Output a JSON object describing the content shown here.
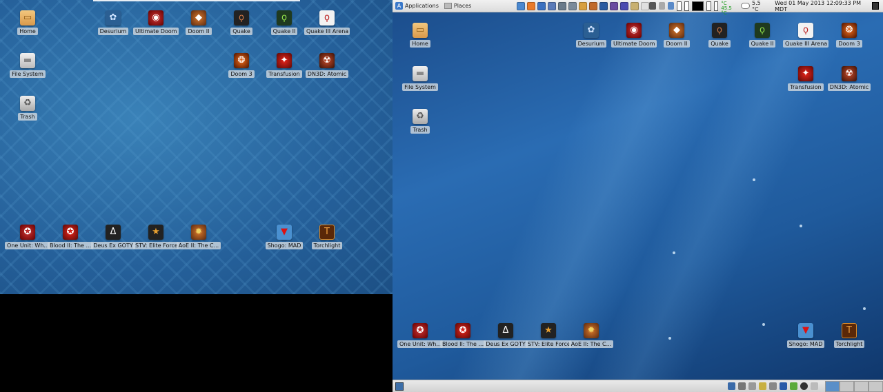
{
  "left_desktop": {
    "icons": [
      {
        "label": "Home",
        "icon": "folder-icon",
        "glyph": "▭"
      },
      {
        "label": "Desurium",
        "icon": "desura-icon",
        "glyph": "✿"
      },
      {
        "label": "Ultimate Doom",
        "icon": "doom-icon",
        "glyph": "◉"
      },
      {
        "label": "Doom II",
        "icon": "doom2-icon",
        "glyph": "◆"
      },
      {
        "label": "Quake",
        "icon": "quake-icon",
        "glyph": "ϙ"
      },
      {
        "label": "Quake II",
        "icon": "quake2-icon",
        "glyph": "ϙ"
      },
      {
        "label": "Quake III Arena",
        "icon": "quake3-icon",
        "glyph": "ϙ"
      },
      {
        "label": "File System",
        "icon": "drive-icon",
        "glyph": "▬"
      },
      {
        "label": "Doom 3",
        "icon": "doom3-icon",
        "glyph": "❂"
      },
      {
        "label": "Transfusion",
        "icon": "transfusion-icon",
        "glyph": "✦"
      },
      {
        "label": "DN3D: Atomic",
        "icon": "duke-icon",
        "glyph": "☢"
      },
      {
        "label": "Trash",
        "icon": "trash-icon",
        "glyph": "♻"
      },
      {
        "label": "One Unit: Wh...",
        "icon": "one-unit-icon",
        "glyph": "✪"
      },
      {
        "label": "Blood II: The ...",
        "icon": "blood2-icon",
        "glyph": "✪"
      },
      {
        "label": "Deus Ex GOTY",
        "icon": "deus-ex-icon",
        "glyph": "Δ"
      },
      {
        "label": "STV: Elite Force",
        "icon": "stv-icon",
        "glyph": "★"
      },
      {
        "label": "AoE II: The C...",
        "icon": "aoe2-icon",
        "glyph": "✹"
      },
      {
        "label": "Shogo: MAD",
        "icon": "shogo-icon",
        "glyph": "▼"
      },
      {
        "label": "Torchlight",
        "icon": "torchlight-icon",
        "glyph": "T"
      }
    ]
  },
  "right_desktop": {
    "top_panel": {
      "applications_label": "Applications",
      "places_label": "Places",
      "temp_cpu": "36.0 °C",
      "temp_gpu": "45.5 °C",
      "weather": "5.5 °C",
      "clock": "Wed 01 May 2013 12:09:33 PM MDT"
    },
    "icons": [
      {
        "label": "Home",
        "icon": "folder-icon",
        "glyph": "▭"
      },
      {
        "label": "Desurium",
        "icon": "desura-icon",
        "glyph": "✿"
      },
      {
        "label": "Ultimate Doom",
        "icon": "doom-icon",
        "glyph": "◉"
      },
      {
        "label": "Doom II",
        "icon": "doom2-icon",
        "glyph": "◆"
      },
      {
        "label": "Quake",
        "icon": "quake-icon",
        "glyph": "ϙ"
      },
      {
        "label": "Quake II",
        "icon": "quake2-icon",
        "glyph": "ϙ"
      },
      {
        "label": "Quake III Arena",
        "icon": "quake3-icon",
        "glyph": "ϙ"
      },
      {
        "label": "Doom 3",
        "icon": "doom3-icon",
        "glyph": "❂"
      },
      {
        "label": "File System",
        "icon": "drive-icon",
        "glyph": "▬"
      },
      {
        "label": "Transfusion",
        "icon": "transfusion-icon",
        "glyph": "✦"
      },
      {
        "label": "DN3D: Atomic",
        "icon": "duke-icon",
        "glyph": "☢"
      },
      {
        "label": "Trash",
        "icon": "trash-icon",
        "glyph": "♻"
      },
      {
        "label": "One Unit: Wh...",
        "icon": "one-unit-icon",
        "glyph": "✪"
      },
      {
        "label": "Blood II: The ...",
        "icon": "blood2-icon",
        "glyph": "✪"
      },
      {
        "label": "Deus Ex GOTY",
        "icon": "deus-ex-icon",
        "glyph": "Δ"
      },
      {
        "label": "STV: Elite Force",
        "icon": "stv-icon",
        "glyph": "★"
      },
      {
        "label": "AoE II: The C...",
        "icon": "aoe2-icon",
        "glyph": "✹"
      },
      {
        "label": "Shogo: MAD",
        "icon": "shogo-icon",
        "glyph": "▼"
      },
      {
        "label": "Torchlight",
        "icon": "torchlight-icon",
        "glyph": "T"
      }
    ]
  }
}
